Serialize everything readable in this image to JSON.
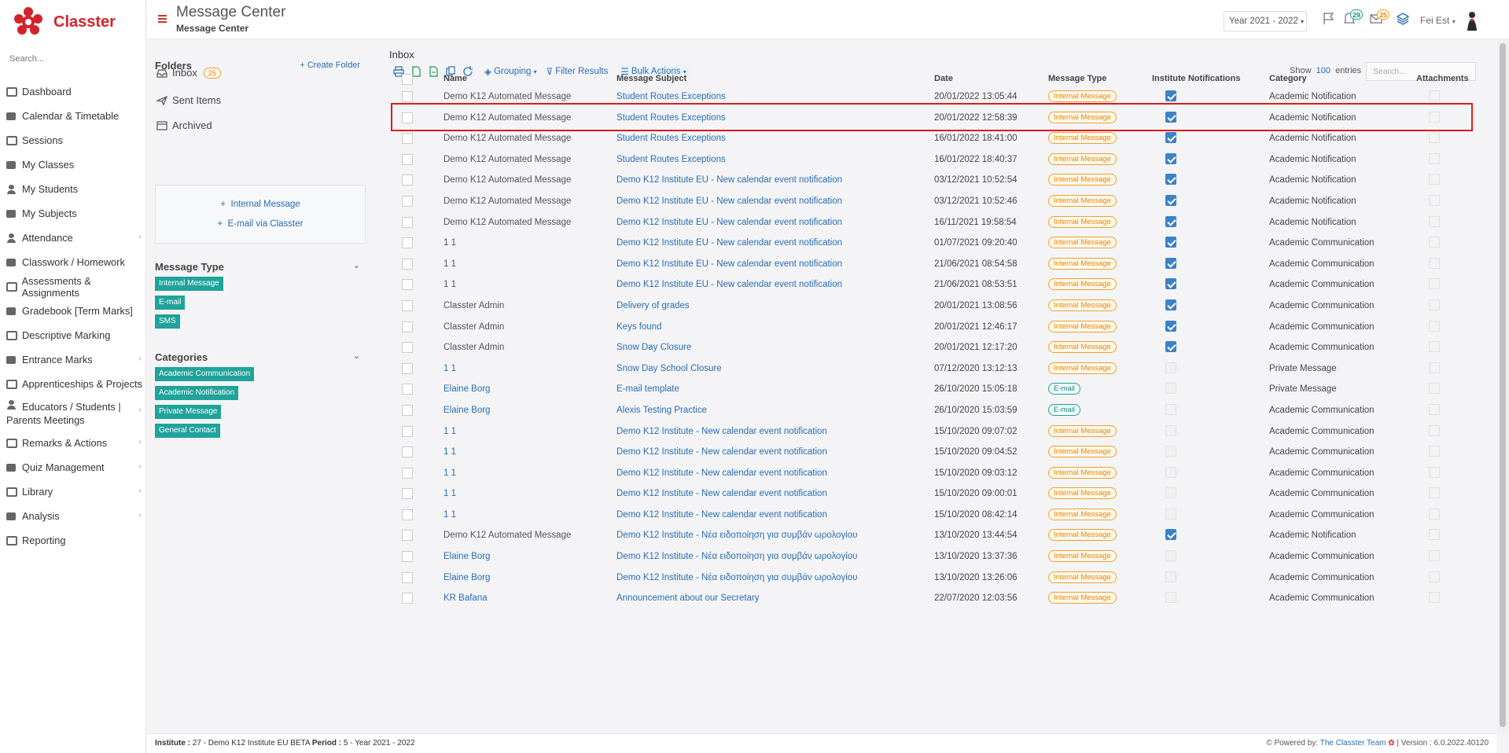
{
  "sidebar": {
    "brand": "Classter",
    "search_placeholder": "Search...",
    "items": [
      {
        "label": "Dashboard",
        "icon": "laptop-icon",
        "has_children": false
      },
      {
        "label": "Calendar & Timetable",
        "icon": "calendar-icon",
        "has_children": false
      },
      {
        "label": "Sessions",
        "icon": "sessions-icon",
        "has_children": false
      },
      {
        "label": "My Classes",
        "icon": "classes-icon",
        "has_children": false
      },
      {
        "label": "My Students",
        "icon": "students-icon",
        "has_children": false
      },
      {
        "label": "My Subjects",
        "icon": "book-icon",
        "has_children": false
      },
      {
        "label": "Attendance",
        "icon": "attendance-icon",
        "has_children": true
      },
      {
        "label": "Classwork / Homework",
        "icon": "list-icon",
        "has_children": false
      },
      {
        "label": "Assessments & Assignments",
        "icon": "edit-icon",
        "has_children": false
      },
      {
        "label": "Gradebook [Term Marks]",
        "icon": "gradebook-icon",
        "has_children": false
      },
      {
        "label": "Descriptive Marking",
        "icon": "marking-icon",
        "has_children": false
      },
      {
        "label": "Entrance Marks",
        "icon": "entrance-icon",
        "has_children": true
      },
      {
        "label": "Apprenticeships & Projects",
        "icon": "cube-icon",
        "has_children": true
      },
      {
        "label": "Educators / Students | Parents Meetings",
        "icon": "meetings-icon",
        "has_children": true
      },
      {
        "label": "Remarks & Actions",
        "icon": "remarks-icon",
        "has_children": true
      },
      {
        "label": "Quiz Management",
        "icon": "quiz-icon",
        "has_children": true
      },
      {
        "label": "Library",
        "icon": "library-icon",
        "has_children": true
      },
      {
        "label": "Analysis",
        "icon": "analysis-icon",
        "has_children": true
      },
      {
        "label": "Reporting",
        "icon": "printer-icon",
        "has_children": false
      }
    ]
  },
  "header": {
    "title": "Message Center",
    "subtitle": "Message Center",
    "year": "Year 2021 - 2022",
    "notif_count": "29",
    "mail_count": "25",
    "user": "Fei Est"
  },
  "folders": {
    "title": "Folders",
    "create_label": "Create Folder",
    "items": [
      {
        "label": "Inbox",
        "badge": "25"
      },
      {
        "label": "Sent Items",
        "badge": ""
      },
      {
        "label": "Archived",
        "badge": ""
      }
    ],
    "compose": [
      "Internal Message",
      "E-mail via Classter"
    ]
  },
  "message_types": {
    "title": "Message Type",
    "items": [
      "Internal Message",
      "E-mail",
      "SMS"
    ]
  },
  "categories": {
    "title": "Categories",
    "items": [
      "Academic Communication",
      "Academic Notification",
      "Private Message",
      "General Contact"
    ]
  },
  "inbox": {
    "title": "Inbox",
    "toolbar": {
      "grouping": "Grouping",
      "filter": "Filter Results",
      "bulk": "Bulk Actions"
    },
    "show_label": "Show",
    "entries_count": "100",
    "entries_label": "entries",
    "search_placeholder": "Search...",
    "columns": [
      "Name",
      "Message Subject",
      "Date",
      "Message Type",
      "Institute Notifications",
      "Category",
      "Attachments"
    ],
    "rows": [
      {
        "name": "Demo K12 Automated Message",
        "name_link": false,
        "subject": "Student Routes Exceptions",
        "date": "20/01/2022 13:05:44",
        "type": "Internal Message",
        "notif": true,
        "category": "Academic Notification"
      },
      {
        "name": "Demo K12 Automated Message",
        "name_link": false,
        "subject": "Student Routes Exceptions",
        "date": "20/01/2022 12:58:39",
        "type": "Internal Message",
        "notif": true,
        "category": "Academic Notification"
      },
      {
        "name": "Demo K12 Automated Message",
        "name_link": false,
        "subject": "Student Routes Exceptions",
        "date": "16/01/2022 18:41:00",
        "type": "Internal Message",
        "notif": true,
        "category": "Academic Notification"
      },
      {
        "name": "Demo K12 Automated Message",
        "name_link": false,
        "subject": "Student Routes Exceptions",
        "date": "16/01/2022 18:40:37",
        "type": "Internal Message",
        "notif": true,
        "category": "Academic Notification"
      },
      {
        "name": "Demo K12 Automated Message",
        "name_link": false,
        "subject": "Demo K12 Institute EU - New calendar event notification",
        "date": "03/12/2021 10:52:54",
        "type": "Internal Message",
        "notif": true,
        "category": "Academic Notification"
      },
      {
        "name": "Demo K12 Automated Message",
        "name_link": false,
        "subject": "Demo K12 Institute EU - New calendar event notification",
        "date": "03/12/2021 10:52:46",
        "type": "Internal Message",
        "notif": true,
        "category": "Academic Notification"
      },
      {
        "name": "Demo K12 Automated Message",
        "name_link": false,
        "subject": "Demo K12 Institute EU - New calendar event notification",
        "date": "16/11/2021 19:58:54",
        "type": "Internal Message",
        "notif": true,
        "category": "Academic Notification"
      },
      {
        "name": "1 1",
        "name_link": false,
        "subject": "Demo K12 Institute EU - New calendar event notification",
        "date": "01/07/2021 09:20:40",
        "type": "Internal Message",
        "notif": true,
        "category": "Academic Communication"
      },
      {
        "name": "1 1",
        "name_link": false,
        "subject": "Demo K12 Institute EU - New calendar event notification",
        "date": "21/06/2021 08:54:58",
        "type": "Internal Message",
        "notif": true,
        "category": "Academic Communication"
      },
      {
        "name": "1 1",
        "name_link": false,
        "subject": "Demo K12 Institute EU - New calendar event notification",
        "date": "21/06/2021 08:53:51",
        "type": "Internal Message",
        "notif": true,
        "category": "Academic Communication"
      },
      {
        "name": "Classter Admin",
        "name_link": false,
        "subject": "Delivery of grades",
        "date": "20/01/2021 13:08:56",
        "type": "Internal Message",
        "notif": true,
        "category": "Academic Communication"
      },
      {
        "name": "Classter Admin",
        "name_link": false,
        "subject": "Keys found",
        "date": "20/01/2021 12:46:17",
        "type": "Internal Message",
        "notif": true,
        "category": "Academic Communication"
      },
      {
        "name": "Classter Admin",
        "name_link": false,
        "subject": "Snow Day Closure",
        "date": "20/01/2021 12:17:20",
        "type": "Internal Message",
        "notif": true,
        "category": "Academic Communication"
      },
      {
        "name": "1 1",
        "name_link": true,
        "subject": "Snow Day School Closure",
        "date": "07/12/2020 13:12:13",
        "type": "Internal Message",
        "notif": false,
        "category": "Private Message"
      },
      {
        "name": "Elaine Borg",
        "name_link": true,
        "subject": "E-mail template",
        "date": "26/10/2020 15:05:18",
        "type": "E-mail",
        "notif": false,
        "category": "Private Message"
      },
      {
        "name": "Elaine Borg",
        "name_link": true,
        "subject": "Alexis Testing Practice",
        "date": "26/10/2020 15:03:59",
        "type": "E-mail",
        "notif": false,
        "category": "Academic Communication"
      },
      {
        "name": "1 1",
        "name_link": true,
        "subject": "Demo K12 Institute - New calendar event notification",
        "date": "15/10/2020 09:07:02",
        "type": "Internal Message",
        "notif": false,
        "category": "Academic Communication"
      },
      {
        "name": "1 1",
        "name_link": true,
        "subject": "Demo K12 Institute - New calendar event notification",
        "date": "15/10/2020 09:04:52",
        "type": "Internal Message",
        "notif": false,
        "category": "Academic Communication"
      },
      {
        "name": "1 1",
        "name_link": true,
        "subject": "Demo K12 Institute - New calendar event notification",
        "date": "15/10/2020 09:03:12",
        "type": "Internal Message",
        "notif": false,
        "category": "Academic Communication"
      },
      {
        "name": "1 1",
        "name_link": true,
        "subject": "Demo K12 Institute - New calendar event notification",
        "date": "15/10/2020 09:00:01",
        "type": "Internal Message",
        "notif": false,
        "category": "Academic Communication"
      },
      {
        "name": "1 1",
        "name_link": true,
        "subject": "Demo K12 Institute - New calendar event notification",
        "date": "15/10/2020 08:42:14",
        "type": "Internal Message",
        "notif": false,
        "category": "Academic Communication"
      },
      {
        "name": "Demo K12 Automated Message",
        "name_link": false,
        "subject": "Demo K12 Institute - Νέα ειδοποίηση για συμβάν ωρολογίου",
        "date": "13/10/2020 13:44:54",
        "type": "Internal Message",
        "notif": true,
        "category": "Academic Notification"
      },
      {
        "name": "Elaine Borg",
        "name_link": true,
        "subject": "Demo K12 Institute - Νέα ειδοποίηση για συμβάν ωρολογίου",
        "date": "13/10/2020 13:37:36",
        "type": "Internal Message",
        "notif": false,
        "category": "Academic Communication"
      },
      {
        "name": "Elaine Borg",
        "name_link": true,
        "subject": "Demo K12 Institute - Νέα ειδοποίηση για συμβάν ωρολογίου",
        "date": "13/10/2020 13:26:06",
        "type": "Internal Message",
        "notif": false,
        "category": "Academic Communication"
      },
      {
        "name": "KR Bafana",
        "name_link": true,
        "subject": "Announcement about our Secretary",
        "date": "22/07/2020 12:03:56",
        "type": "Internal Message",
        "notif": false,
        "category": "Academic Communication"
      }
    ]
  },
  "footer": {
    "institute_label": "Institute :",
    "institute": "27 - Demo K12 Institute EU BETA",
    "period_label": "Period :",
    "period": "5 - Year 2021 - 2022",
    "powered_label": "Powered by:",
    "powered_by": "The Classter Team",
    "version": "| Version : 6.0.2022.40120"
  },
  "colors": {
    "brand": "#d2232a",
    "link": "#2a6db3",
    "tag": "#1fa39a",
    "internal_badge": "#f0a030",
    "checked": "#3b82c8",
    "highlight": "#e01b1b"
  }
}
